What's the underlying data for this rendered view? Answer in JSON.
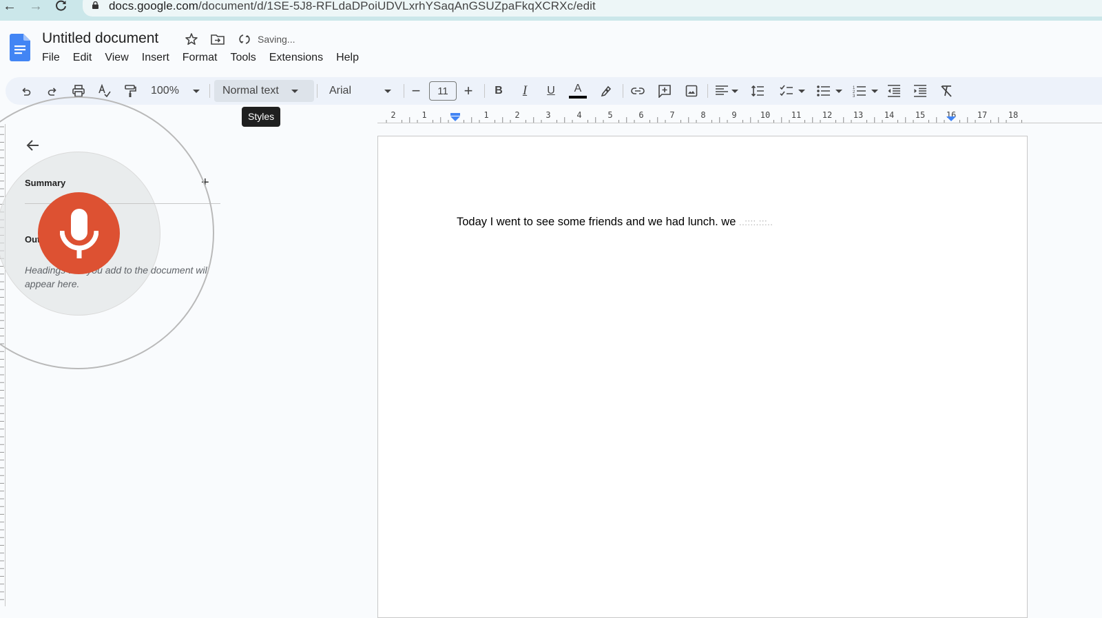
{
  "browser": {
    "url_host": "docs.google.com",
    "url_path": "/document/d/1SE-5J8-RFLdaDPoiUDVLxrhYSaqAnGSUZpaFkqXCRXc/edit",
    "icons": [
      "back-icon",
      "forward-icon",
      "reload-icon",
      "lock-icon"
    ]
  },
  "header": {
    "title": "Untitled document",
    "status": "Saving...",
    "icons": [
      "docs-logo",
      "star-icon",
      "move-to-folder-icon",
      "sync-icon"
    ],
    "menu": [
      "File",
      "Edit",
      "View",
      "Insert",
      "Format",
      "Tools",
      "Extensions",
      "Help"
    ]
  },
  "toolbar": {
    "zoom": "100%",
    "paragraph_style": "Normal text",
    "font": "Arial",
    "font_size": "11",
    "tooltip": "Styles",
    "buttons": [
      "undo",
      "redo",
      "print",
      "spelling-grammar",
      "paint-format",
      "decrease-font-size",
      "increase-font-size",
      "bold",
      "italic",
      "underline",
      "text-color",
      "highlight-color",
      "insert-link",
      "add-comment",
      "insert-image",
      "align",
      "line-spacing",
      "checklist",
      "bulleted-list",
      "numbered-list",
      "decrease-indent",
      "increase-indent",
      "clear-formatting"
    ],
    "text_color": "#000000"
  },
  "ruler": {
    "left_labels": [
      "2",
      "1"
    ],
    "labels": [
      "1",
      "2",
      "3",
      "4",
      "5",
      "6",
      "7",
      "8",
      "9",
      "10",
      "11",
      "12",
      "13",
      "14",
      "15",
      "16",
      "17",
      "18"
    ],
    "marker_color": "#4285f4"
  },
  "outline": {
    "summary_label": "Summary",
    "outline_label": "Outline",
    "hint": "Headings that you add to the document will appear here.",
    "add_symbol": "+"
  },
  "voice_typing": {
    "mic_color": "#dd5132",
    "active": true
  },
  "document": {
    "text": "Today I went to see some friends and we had lunch. we ",
    "interim": "..::::.:::.."
  }
}
